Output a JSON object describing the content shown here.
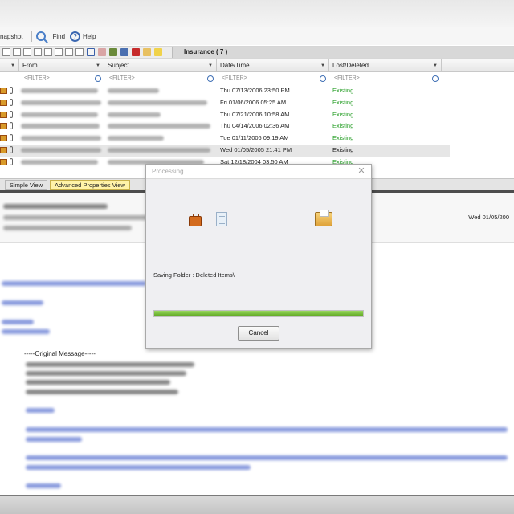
{
  "toolbar": {
    "snapshot_label": "napshot",
    "find_label": "Find",
    "help_label": "Help",
    "help_glyph": "?"
  },
  "folder": {
    "name": "Insurance ( 7 )"
  },
  "grid": {
    "columns": [
      "From",
      "Subject",
      "Date/Time",
      "Lost/Deleted"
    ],
    "filter_placeholder": "<FILTER>",
    "rows": [
      {
        "date": "Thu 07/13/2006 23:50 PM",
        "status": "Existing",
        "status_color": "#2aa02a"
      },
      {
        "date": "Fri 01/06/2006 05:25 AM",
        "status": "Existing",
        "status_color": "#2aa02a"
      },
      {
        "date": "Thu 07/21/2006 10:58 AM",
        "status": "Existing",
        "status_color": "#2aa02a"
      },
      {
        "date": "Thu 04/14/2006 02:36 AM",
        "status": "Existing",
        "status_color": "#2aa02a"
      },
      {
        "date": "Tue 01/11/2006 09:19 AM",
        "status": "Existing",
        "status_color": "#2aa02a"
      },
      {
        "date": "Wed 01/05/2005 21:41 PM",
        "status": "Existing",
        "status_color": "#222222"
      },
      {
        "date": "Sat 12/18/2004 03:50 AM",
        "status": "Existing",
        "status_color": "#2aa02a"
      }
    ]
  },
  "view_tabs": {
    "simple": "Simple View",
    "advanced": "Advanced Properties View"
  },
  "preview": {
    "date": "Wed 01/05/200",
    "original_message": "-----Original Message-----"
  },
  "dialog": {
    "title": "Processing...",
    "close_glyph": "✕",
    "status": "Saving Folder : Deleted Items\\",
    "progress": 1.0,
    "cancel_label": "Cancel"
  }
}
